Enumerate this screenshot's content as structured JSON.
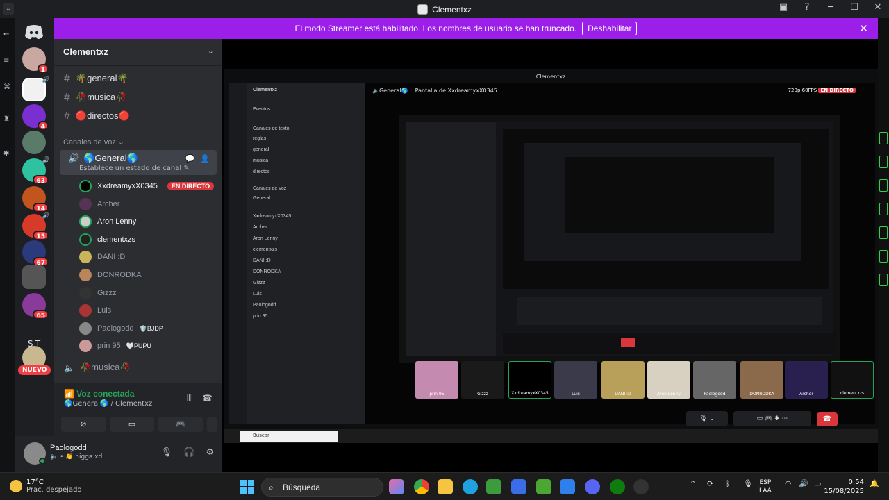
{
  "window": {
    "title": "Clementxz"
  },
  "banner": {
    "text": "El modo Streamer está habilitado. Los nombres de usuario se han truncado.",
    "button": "Deshabilitar"
  },
  "rail": {
    "badges": [
      "1",
      "4",
      "63",
      "14",
      "15",
      "67",
      "65"
    ],
    "st_label": "S-T",
    "nuevo": "NUEVO"
  },
  "server": {
    "name": "Clementxz"
  },
  "channels": {
    "text": [
      {
        "label": "🌴general🌴"
      },
      {
        "label": "🥀musica🥀"
      },
      {
        "label": "🔴directos🔴"
      }
    ],
    "voice_category": "Canales de voz",
    "active_voice": {
      "label": "🌎General🌎",
      "status": "Establece un estado de canal"
    },
    "members": [
      {
        "name": "XxdreamyxX0345",
        "live": "EN DIRECTO"
      },
      {
        "name": "Archer"
      },
      {
        "name": "Aron Lenny"
      },
      {
        "name": "clementxzs"
      },
      {
        "name": "DANI :D"
      },
      {
        "name": "DONRODKA"
      },
      {
        "name": "Gizzz"
      },
      {
        "name": "Luis"
      },
      {
        "name": "Paologodd",
        "tag": "🛡️BJDP"
      },
      {
        "name": "prin 95",
        "tag": "🤍PUPU"
      }
    ],
    "next_voice": "🥀musica🥀"
  },
  "voice_panel": {
    "title": "Voz conectada",
    "subtitle": "🌎General🌎 / Clementxz"
  },
  "user": {
    "name": "Paologodd",
    "status": "🔈 • 👏 nigga xd"
  },
  "stream": {
    "inner_title": "Clementxz",
    "inner_channel": "🔈General🌎",
    "inner_screen": "Pantalla de XxdreamyxX0345",
    "inner_quality": "720p 60FPS",
    "inner_live": "EN DIRECTO",
    "inner_server": "Clementxz",
    "inner_search": "Buscar",
    "inner_sidebar": [
      "Eventos",
      "Canales de texto",
      "reglas",
      "general",
      "musica",
      "directos",
      "Canales de voz",
      "General",
      "XxdreamyxX0345",
      "Archer",
      "Aron Lenny",
      "clementxzs",
      "DANI :D",
      "DONRODKA",
      "Gizzz",
      "Luis",
      "Paologodd",
      "prin 95"
    ],
    "tiles": [
      "prin 95",
      "Gizzz",
      "XxdreamyxX0345",
      "Luis",
      "DANI :D",
      "Aron Lenny",
      "Paologodd",
      "DONRODKA",
      "Archer",
      "clementxzs"
    ]
  },
  "taskbar": {
    "temp": "17°C",
    "condition": "Prac. despejado",
    "search": "Búsqueda",
    "lang_top": "ESP",
    "lang_bottom": "LAA",
    "time": "0:54",
    "date": "15/08/2025"
  }
}
